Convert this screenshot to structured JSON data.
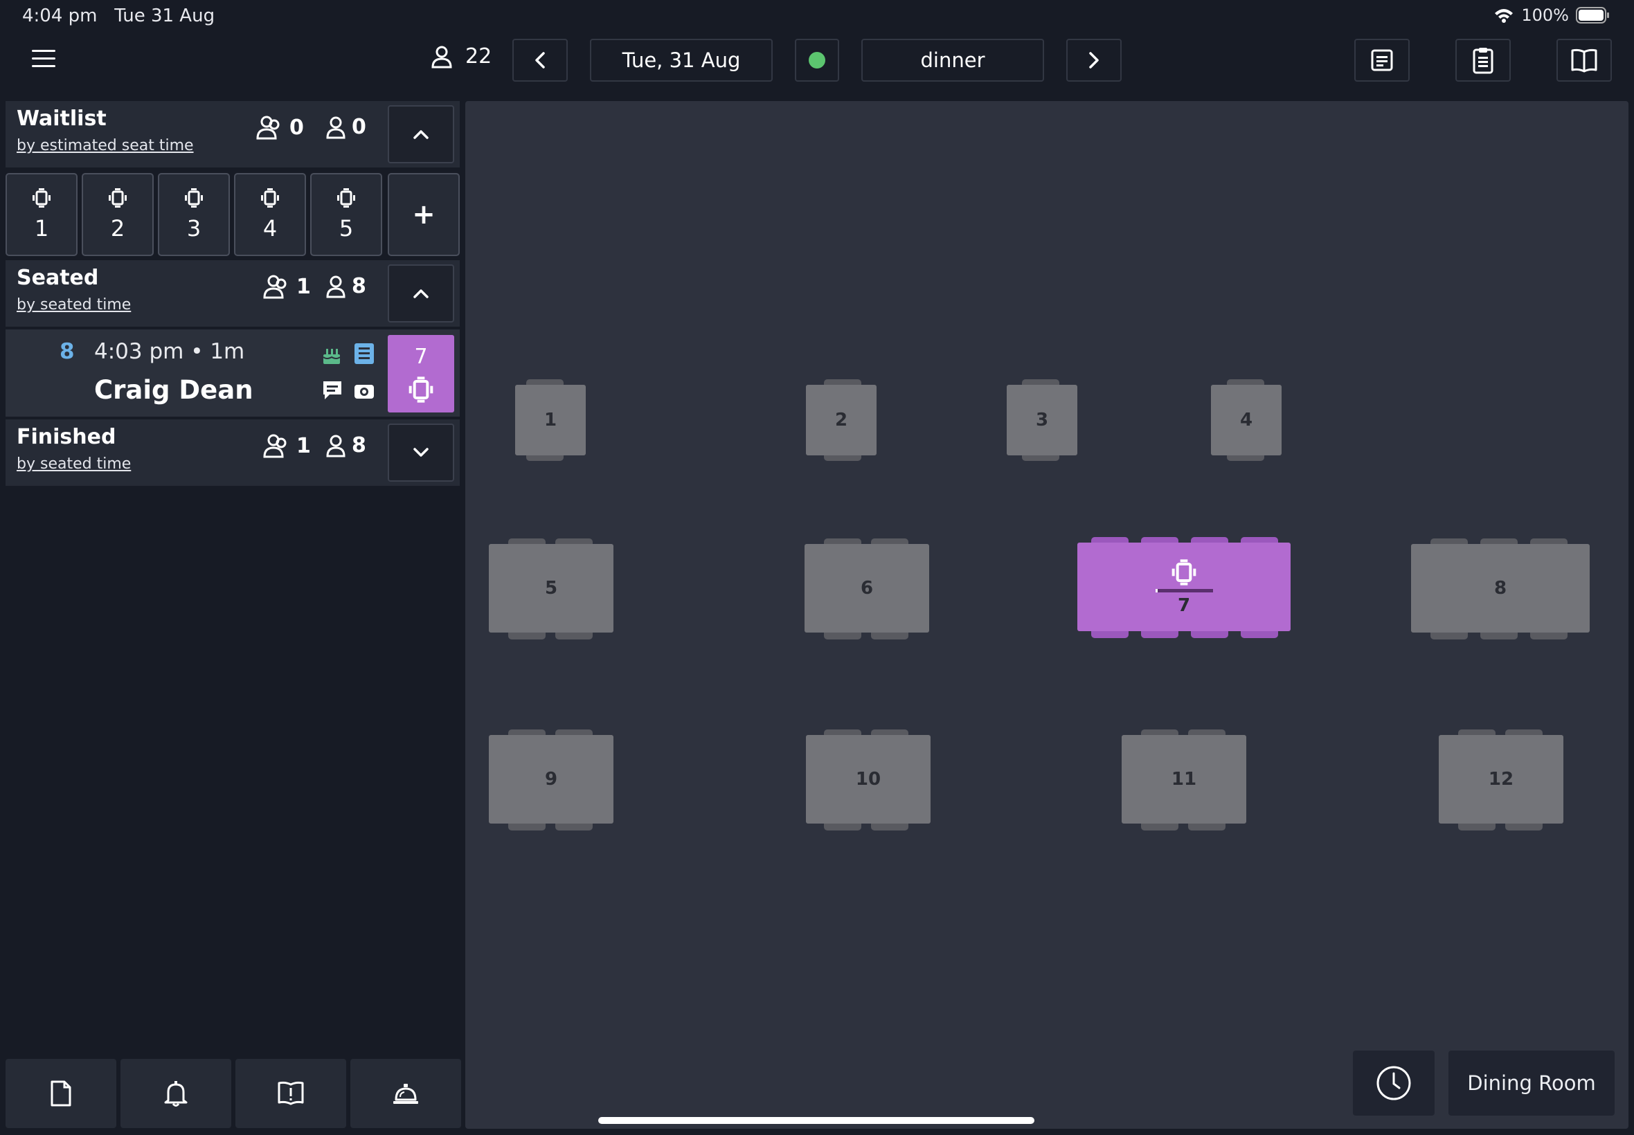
{
  "status_bar": {
    "time": "4:04 pm",
    "date": "Tue 31 Aug",
    "battery": "100%"
  },
  "top_bar": {
    "party_count": "22",
    "date": "Tue, 31 Aug",
    "shift": "dinner",
    "status_color": "#5cc56f"
  },
  "waitlist": {
    "title": "Waitlist",
    "sort": "by estimated seat time",
    "parties": "0",
    "guests": "0",
    "quick_add": [
      "1",
      "2",
      "3",
      "4",
      "5"
    ],
    "add_label": "+"
  },
  "seated": {
    "title": "Seated",
    "sort": "by seated time",
    "parties": "1",
    "guests": "8",
    "reservation": {
      "covers": "8",
      "time": "4:03 pm • 1m",
      "name": "Craig Dean",
      "table": "7"
    }
  },
  "finished": {
    "title": "Finished",
    "sort": "by seated time",
    "parties": "1",
    "guests": "8"
  },
  "floor": {
    "room_name": "Dining Room",
    "tables": [
      "1",
      "2",
      "3",
      "4",
      "5",
      "6",
      "7",
      "8",
      "9",
      "10",
      "11",
      "12"
    ],
    "active_table": "7",
    "active_color": "#b26bd0"
  }
}
